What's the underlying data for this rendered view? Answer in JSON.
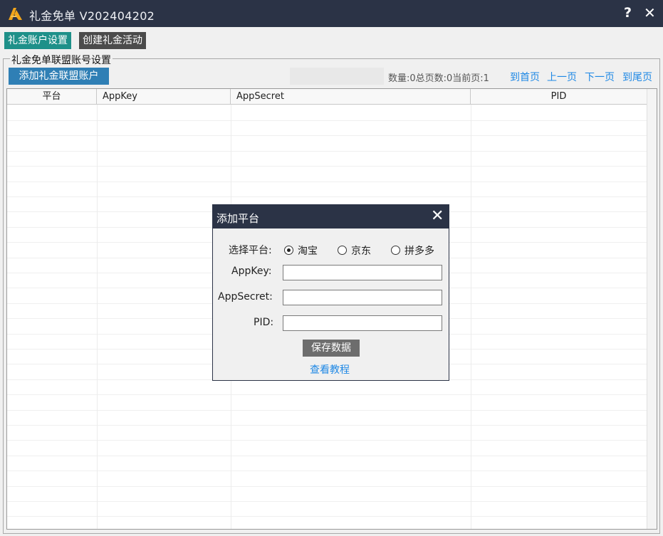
{
  "window": {
    "title": "礼金免单 V202404202",
    "help_glyph": "?",
    "close_glyph": "✕"
  },
  "tabs": [
    {
      "label": "礼金账户设置"
    },
    {
      "label": "创建礼金活动"
    }
  ],
  "group": {
    "legend": "礼金免单联盟账号设置",
    "add_button": "添加礼金联盟账户"
  },
  "pager": {
    "info": "数量:0总页数:0当前页:1",
    "first": "到首页",
    "prev": "上一页",
    "next": "下一页",
    "last": "到尾页"
  },
  "table": {
    "headers": [
      "平台",
      "AppKey",
      "AppSecret",
      "PID"
    ],
    "rows": []
  },
  "dialog": {
    "title": "添加平台",
    "close_glyph": "✕",
    "platform_label": "选择平台:",
    "platforms": [
      "淘宝",
      "京东",
      "拼多多"
    ],
    "selected_platform": "淘宝",
    "appkey_label": "AppKey:",
    "appsecret_label": "AppSecret:",
    "pid_label": "PID:",
    "appkey_value": "",
    "appsecret_value": "",
    "pid_value": "",
    "save_button": "保存数据",
    "tutorial_link": "查看教程"
  },
  "colors": {
    "titlebar": "#2b3346",
    "tab_active": "#1e9089",
    "tab_inactive": "#4b4b4b",
    "add_button": "#2f7fb5",
    "link": "#1e88e5",
    "save_button": "#6d6d6d"
  },
  "icons": {
    "logo": "app-logo-icon",
    "help": "help-icon",
    "close": "close-icon"
  }
}
